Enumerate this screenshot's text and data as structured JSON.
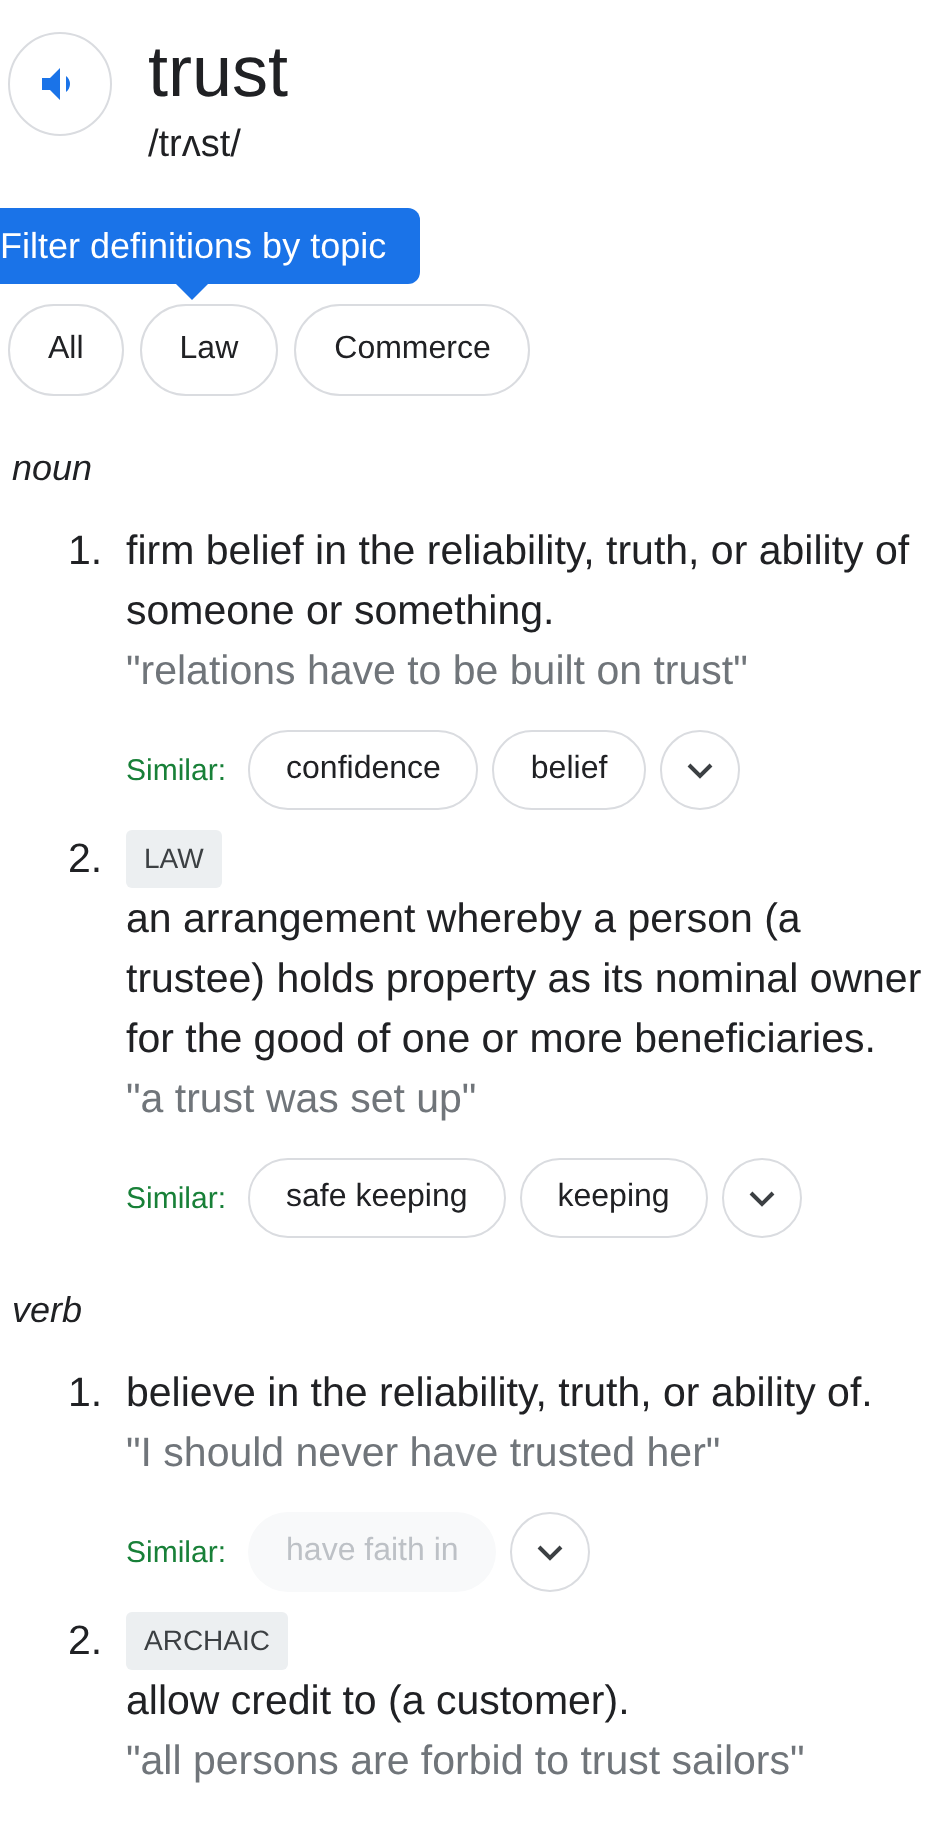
{
  "headword": {
    "word": "trust",
    "pronunciation": "/trʌst/"
  },
  "tooltip": {
    "text": "Filter definitions by topic"
  },
  "topics": [
    {
      "label": "All",
      "selected": false
    },
    {
      "label": "Law",
      "selected": false
    },
    {
      "label": "Commerce",
      "selected": false
    }
  ],
  "senses": [
    {
      "part_of_speech": "noun",
      "definitions": [
        {
          "number": "1.",
          "definition": "firm belief in the reliability, truth, or ability of someone or something.",
          "example": "\"relations have to be built on trust\"",
          "similar_label": "Similar:",
          "similar": [
            {
              "word": "confidence",
              "disabled": false
            },
            {
              "word": "belief",
              "disabled": false
            }
          ],
          "expandable": true
        },
        {
          "number": "2.",
          "tag": "LAW",
          "definition": "an arrangement whereby a person (a trustee) holds property as its nominal owner for the good of one or more beneficiaries.",
          "example": "\"a trust was set up\"",
          "similar_label": "Similar:",
          "similar": [
            {
              "word": "safe keeping",
              "disabled": false
            },
            {
              "word": "keeping",
              "disabled": false
            }
          ],
          "expandable": true
        }
      ]
    },
    {
      "part_of_speech": "verb",
      "definitions": [
        {
          "number": "1.",
          "definition": "believe in the reliability, truth, or ability of.",
          "example": "\"I should never have trusted her\"",
          "similar_label": "Similar:",
          "similar": [
            {
              "word": "have faith in",
              "disabled": true
            }
          ],
          "expandable": true
        },
        {
          "number": "2.",
          "tag": "ARCHAIC",
          "definition": "allow credit to (a customer).",
          "example": "\"all persons are forbid to trust sailors\""
        }
      ]
    }
  ]
}
